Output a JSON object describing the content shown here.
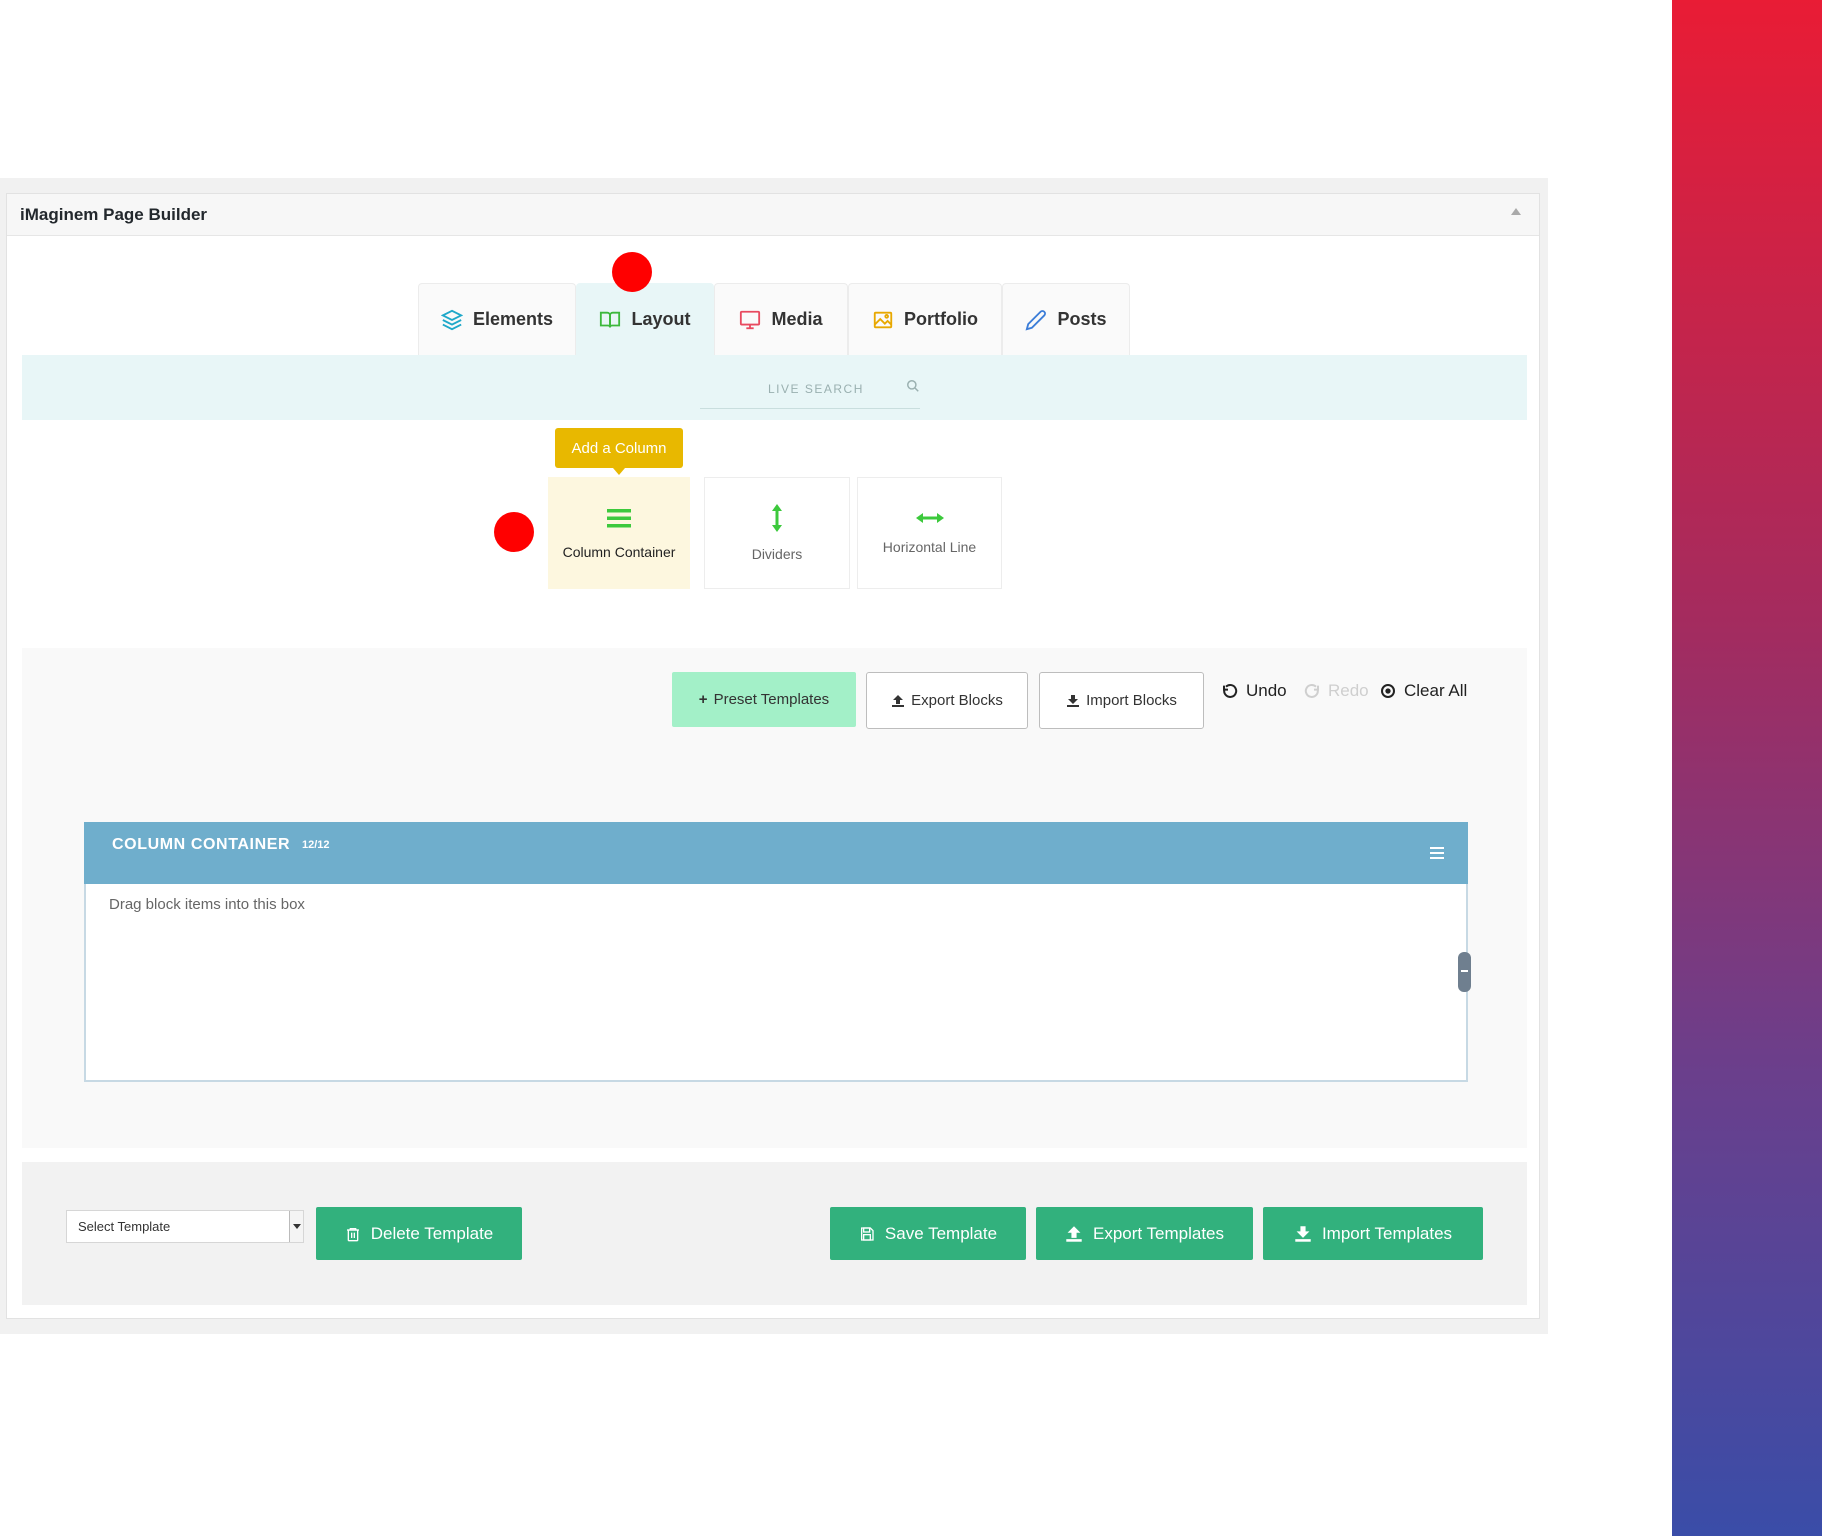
{
  "panel": {
    "title": "iMaginem Page Builder"
  },
  "tabs": [
    {
      "label": "Elements"
    },
    {
      "label": "Layout"
    },
    {
      "label": "Media"
    },
    {
      "label": "Portfolio"
    },
    {
      "label": "Posts"
    }
  ],
  "search": {
    "placeholder": "LIVE SEARCH"
  },
  "tooltip": {
    "text": "Add a Column"
  },
  "layout_items": [
    {
      "label": "Column Container"
    },
    {
      "label": "Dividers"
    },
    {
      "label": "Horizontal Line"
    }
  ],
  "toolbar": {
    "preset": "Preset Templates",
    "export_blocks": "Export Blocks",
    "import_blocks": "Import Blocks",
    "undo": "Undo",
    "redo": "Redo",
    "clear_all": "Clear All"
  },
  "column_container": {
    "title": "COLUMN CONTAINER",
    "size": "12/12",
    "hint": "Drag block items into this box"
  },
  "footer": {
    "select_value": "Select Template",
    "delete": "Delete Template",
    "save": "Save Template",
    "export": "Export Templates",
    "import": "Import Templates"
  },
  "colors": {
    "accent_green": "#32b17d",
    "tooltip_yellow": "#e8b800",
    "column_header_blue": "#6faecc",
    "marker_red": "#ff0000"
  }
}
